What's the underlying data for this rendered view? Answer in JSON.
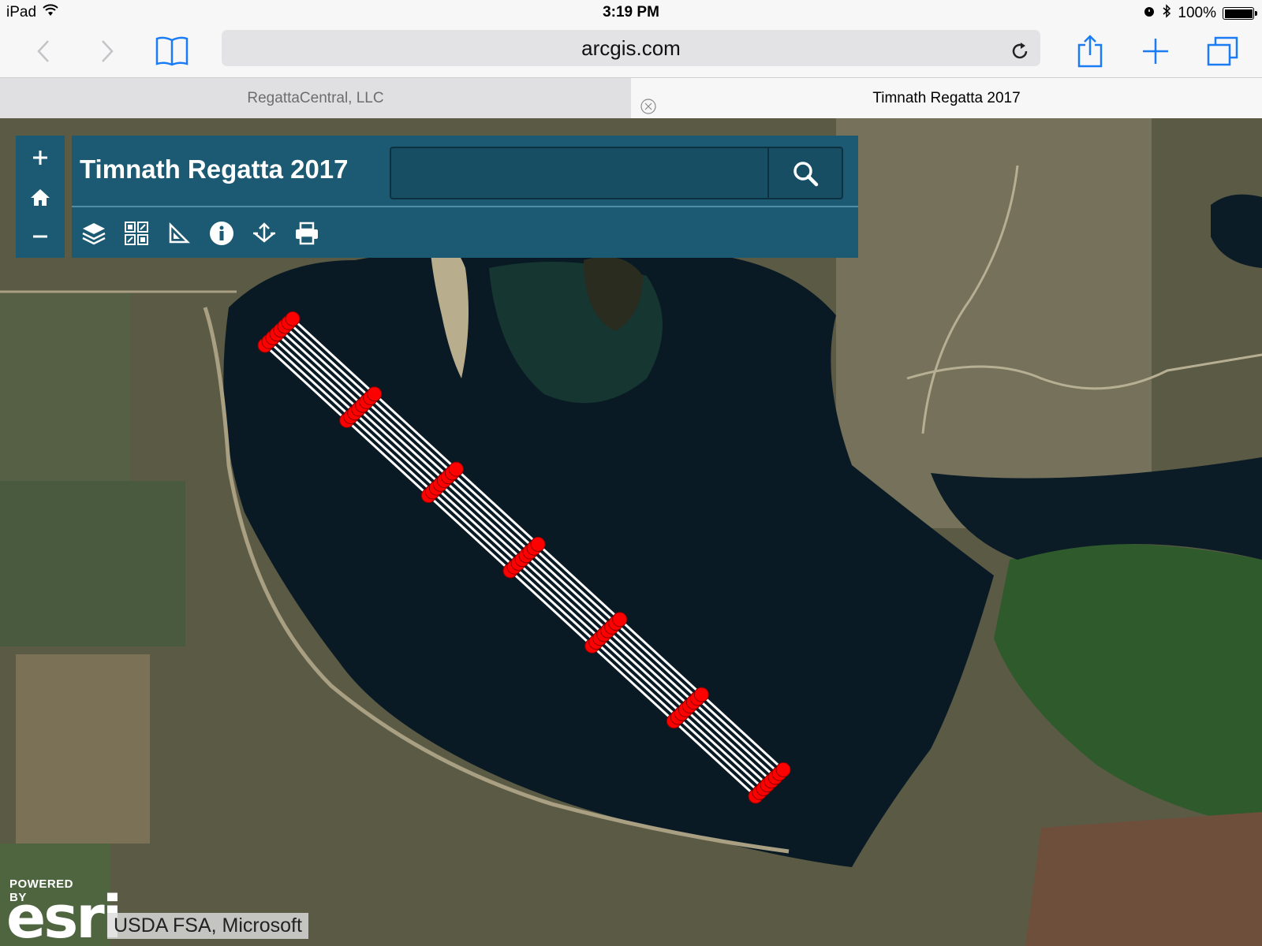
{
  "status_bar": {
    "device": "iPad",
    "time": "3:19 PM",
    "battery": "100%",
    "battery_fill": 1.0
  },
  "toolbar": {
    "url": "arcgis.com"
  },
  "tabs": [
    {
      "label": "RegattaCentral, LLC",
      "active": false
    },
    {
      "label": "Timnath Regatta 2017",
      "active": true
    }
  ],
  "map": {
    "title": "Timnath Regatta 2017",
    "search": {
      "value": "",
      "placeholder": ""
    },
    "zoom": {
      "in": "+",
      "out": "−"
    },
    "tools": [
      "layers-icon",
      "basemap-gallery-icon",
      "measure-icon",
      "info-icon",
      "share-icon",
      "print-icon"
    ],
    "attribution": {
      "powered_by": "POWERED BY",
      "logo": "esri",
      "credit": "USDA FSA, Microsoft"
    },
    "colors": {
      "panel": "#1c5972",
      "buoy": "#ff0000",
      "lane_line": "#ffffff",
      "water": "#0a1a24"
    },
    "course": {
      "lanes": 8,
      "markers_per_lane": 7
    }
  }
}
